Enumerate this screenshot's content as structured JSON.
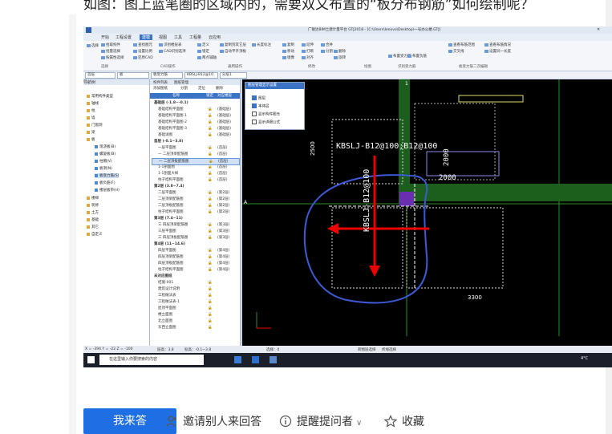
{
  "question_title": "如图：图上蓝笔圈的区域内的，需要双又布置的“板分布钢筋”如何绘制呢？",
  "app": {
    "title": "广联达BIM土建计量平台 GTJ2018 - [C:\\Users\\lenovo\\Desktop\\一号办公楼.GTJ]",
    "tabs": [
      "开始",
      "工程设置",
      "建模",
      "视图",
      "工具",
      "工程量",
      "云应用"
    ],
    "active_tab": "建模",
    "ribbon_items": [
      "选择",
      "拾取构件",
      "批量选择",
      "按属性选择",
      "查找图元",
      "设置比例",
      "还原CAD",
      "识别楼层表",
      "CAD识别选项",
      "定义",
      "复制到其它层",
      "自动平齐顶板",
      "锁定",
      "两点辅轴",
      "长度标注",
      "复制",
      "移动",
      "镜像",
      "延伸",
      "打断",
      "对齐",
      "合并",
      "删除",
      "分割",
      "旋转",
      "布置受力筋",
      "布置负筋",
      "查看布筋范围",
      "交叉线",
      "查看布筋情况",
      "设置同一长度"
    ],
    "ribbon_groups": [
      "选择",
      "CAD操作",
      "通用操作",
      "修改",
      "绘图",
      "识别受力筋",
      "板受力筋二次编辑"
    ],
    "combos": [
      "首层",
      "板",
      "板受力筋",
      "KBSLJ-B12@10",
      "分层1"
    ],
    "nav": {
      "header": "导航树",
      "items": [
        "常用构件类型",
        "轴线",
        "柱",
        "墙",
        "门窗洞",
        "梁",
        "板",
        "楼梯",
        "装修",
        "土方",
        "基础",
        "其它",
        "自定义"
      ],
      "board_children": [
        "现浇板(B)",
        "螺旋板(B)",
        "柱帽(V)",
        "板洞(N)",
        "板受力筋(S)",
        "板负筋(F)",
        "楼层板带(H)"
      ],
      "selected": "板受力筋(S)"
    },
    "tree": {
      "tabs": [
        "构件列表",
        "图纸管理"
      ],
      "toolbar": [
        "添加图纸",
        "分割",
        "定位",
        "删除"
      ],
      "headers": [
        "名称",
        "锁定",
        "对应楼层"
      ],
      "rows": [
        {
          "name": "基础层 (-1.8~-0.1)",
          "floor": "",
          "folder": true
        },
        {
          "name": "基础结构平面图",
          "floor": "(基础层)"
        },
        {
          "name": "基础结构平面图-1",
          "floor": "(基础层)"
        },
        {
          "name": "基础结构平面图-2",
          "floor": "(基础层)"
        },
        {
          "name": "基础结构平面图-3",
          "floor": "(基础层)"
        },
        {
          "name": "基础详图",
          "floor": "(基础层)"
        },
        {
          "name": "首层 (-0.1~3.8)",
          "floor": "",
          "folder": true
        },
        {
          "name": "一层平面图",
          "floor": "(首层)"
        },
        {
          "name": "一 二层顶梁配筋图",
          "floor": "(首层)"
        },
        {
          "name": "一 二层顶板配筋图",
          "floor": "(首层)",
          "selected": true
        },
        {
          "name": "1-1剖面图",
          "floor": "(首层)"
        },
        {
          "name": "1-1剖面大样",
          "floor": "(首层)"
        },
        {
          "name": "柱子结构平面图",
          "floor": "(首层)"
        },
        {
          "name": "第2层 (3.8~7.4)",
          "floor": "",
          "folder": true
        },
        {
          "name": "二层平面图",
          "floor": "(第2层)"
        },
        {
          "name": "二层顶梁配筋图",
          "floor": "(第2层)"
        },
        {
          "name": "二层顶板配筋图",
          "floor": "(第2层)"
        },
        {
          "name": "柱子结构平面图",
          "floor": "(第2层)"
        },
        {
          "name": "第3层 (7.4~11)",
          "floor": "",
          "folder": true
        },
        {
          "name": "三 四层顶梁配筋图",
          "floor": "(第3层)"
        },
        {
          "name": "三层平面图",
          "floor": "(第3层)"
        },
        {
          "name": "三 四层顶板配筋图",
          "floor": "(第3层)"
        },
        {
          "name": "第4层 (11~14.6)",
          "floor": "",
          "folder": true
        },
        {
          "name": "四层平面图",
          "floor": "(第4层)"
        },
        {
          "name": "四层顶梁配筋图",
          "floor": "(第4层)"
        },
        {
          "name": "四层顶板配筋图",
          "floor": "(第4层)"
        },
        {
          "name": "柱子结构平面图",
          "floor": "(第4层)"
        },
        {
          "name": "未对应图纸",
          "floor": "",
          "folder": true
        },
        {
          "name": "结施-001",
          "floor": ""
        },
        {
          "name": "建筑设计说明",
          "floor": ""
        },
        {
          "name": "工程做法表",
          "floor": ""
        },
        {
          "name": "工程做法表-1",
          "floor": ""
        },
        {
          "name": "屋顶平面图",
          "floor": ""
        },
        {
          "name": "楼立面图",
          "floor": ""
        },
        {
          "name": "北立面图",
          "floor": ""
        },
        {
          "name": "东西立面图",
          "floor": ""
        }
      ]
    },
    "dialog": {
      "title": "图层管理显示设置",
      "options": [
        {
          "label": "图层",
          "checked": true
        },
        {
          "label": "本体层",
          "checked": true
        },
        {
          "label": "显示构件图元",
          "checked": false
        },
        {
          "label": "显示详细公式",
          "checked": false
        }
      ]
    },
    "cad": {
      "rebar_label_h": "KBSLJ-B12@100;B12@100",
      "rebar_label_v": "KBSLJ-B12@100",
      "dim_2000_a": "2000",
      "dim_2000_b": "2000",
      "dim_2500": "2500",
      "dim_3300": "3300",
      "axis_1": "1",
      "axis_a": "A"
    },
    "status": [
      "X = -394 Y = -22 Z = -100",
      "层高：3.8",
      "标高：-0.1~3.8",
      "选择：0",
      "跨图层选择",
      "折线选择"
    ],
    "taskbar_search": "在这里输入你要搜索的内容",
    "taskbar_time": "4°C"
  },
  "bottom": {
    "answer": "我来答",
    "invite": "邀请别人来回答",
    "remind": "提醒提问者",
    "favorite": "收藏"
  }
}
